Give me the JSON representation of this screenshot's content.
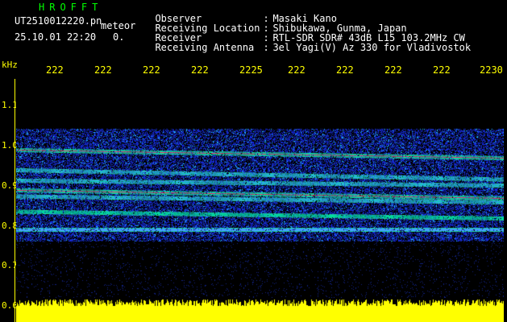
{
  "header": {
    "app_title": "HROFFT",
    "file_name": "UT2510012220.pn",
    "meteor_label": "meteor",
    "date_time": "25.10.01 22:20",
    "meteor_count": "0.",
    "info": [
      {
        "key": "Observer",
        "value": "Masaki Kano"
      },
      {
        "key": "Receiving Location",
        "value": "Shibukawa, Gunma, Japan"
      },
      {
        "key": "Receiver",
        "value": "RTL-SDR SDR# 43dB L15 103.2MHz CW"
      },
      {
        "key": "Receiving Antenna",
        "value": "3el Yagi(V) Az 330 for Vladivostok"
      }
    ]
  },
  "axes": {
    "y_unit": "kHz",
    "x_ticks": [
      "222",
      "222",
      "222",
      "222",
      "2225",
      "222",
      "222",
      "222",
      "222",
      "2230"
    ],
    "y_ticks": [
      "1.1",
      "1.0",
      "0.9",
      "0.8",
      "0.7",
      "0.6"
    ]
  },
  "colors": {
    "background": "#000000",
    "label": "#ffff00",
    "title": "#00ff00",
    "signal_strong": "#ff3070",
    "signal_mid": "#00e0a0",
    "noise": "#2040ff"
  },
  "spectrogram": {
    "bands_khz": [
      {
        "freq_start": 0.988,
        "freq_end": 0.968,
        "strength": 1.0
      },
      {
        "freq_start": 0.888,
        "freq_end": 0.868,
        "strength": 0.95
      },
      {
        "freq_start": 0.938,
        "freq_end": 0.915,
        "strength": 0.6
      },
      {
        "freq_start": 0.912,
        "freq_end": 0.9,
        "strength": 0.55
      },
      {
        "freq_start": 0.873,
        "freq_end": 0.858,
        "strength": 0.55
      },
      {
        "freq_start": 0.835,
        "freq_end": 0.818,
        "strength": 0.7
      },
      {
        "freq_start": 0.79,
        "freq_end": 0.79,
        "strength": 0.35
      }
    ]
  }
}
